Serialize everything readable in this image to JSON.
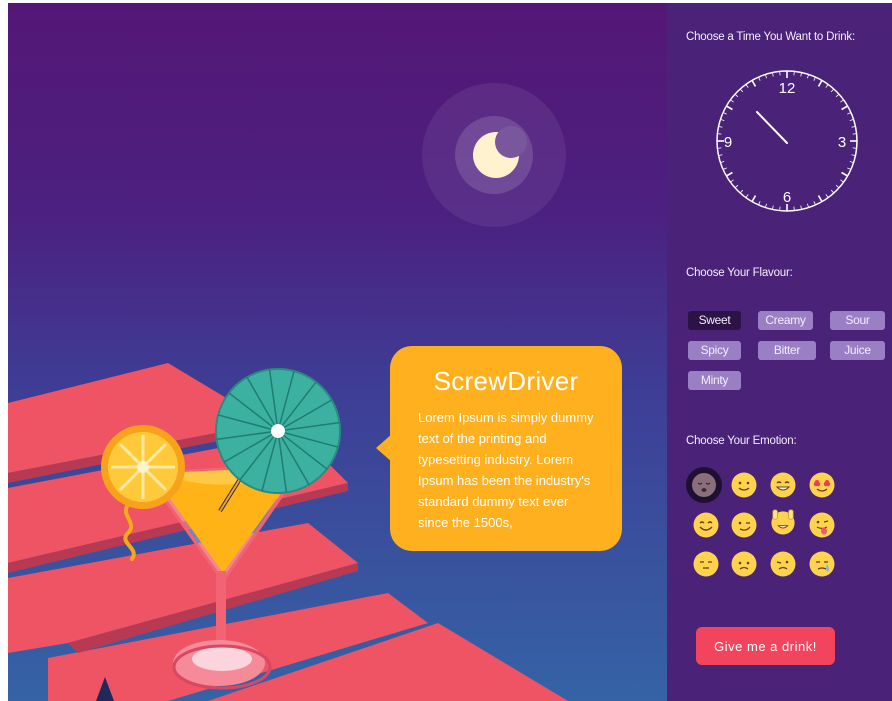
{
  "drink": {
    "name": "ScrewDriver",
    "description": "Lorem Ipsum is simply dummy text of the printing and typesetting industry. Lorem Ipsum has been the industry's standard dummy text ever since the 1500s,"
  },
  "time": {
    "label": "Choose a Time You Want to Drink:",
    "numbers": [
      "12",
      "3",
      "6",
      "9"
    ]
  },
  "flavour": {
    "label": "Choose Your Flavour:",
    "options": [
      "Sweet",
      "Creamy",
      "Sour",
      "Spicy",
      "Bitter",
      "Juice",
      "Minty"
    ],
    "selected": "Sweet"
  },
  "emotion": {
    "label": "Choose Your Emotion:",
    "icons": [
      "sleepy-face-icon",
      "smiling-face-icon",
      "grinning-face-icon",
      "heart-eyes-face-icon",
      "happy-face-icon",
      "smirking-face-icon",
      "hands-raised-face-icon",
      "tongue-out-face-icon",
      "neutral-face-icon",
      "sad-face-icon",
      "winking-face-icon",
      "crying-face-icon"
    ],
    "selected_index": 0
  },
  "cta": {
    "label": "Give me a drink!"
  },
  "colors": {
    "accent": "#f2455d",
    "bubble": "#ffb01f",
    "panel": "#4a2278",
    "chip": "#9b7fc4",
    "chip_active": "#2d1248",
    "emoji": "#ffd34d"
  }
}
